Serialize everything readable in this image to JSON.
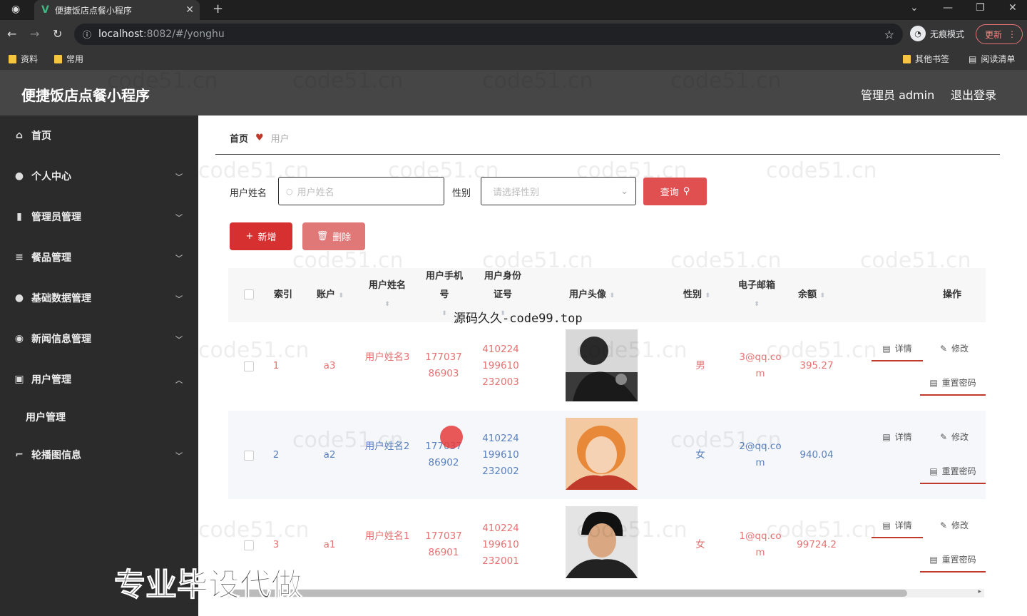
{
  "browser": {
    "tab_title": "便捷饭店点餐小程序",
    "url_host": "localhost",
    "url_path": ":8082/#/yonghu",
    "incognito_label": "无痕模式",
    "update_label": "更新",
    "bookmarks": [
      "资料",
      "常用"
    ],
    "bookmarks_right": [
      "其他书签",
      "阅读清单"
    ]
  },
  "header": {
    "title": "便捷饭店点餐小程序",
    "user": "管理员 admin",
    "logout": "退出登录"
  },
  "sidebar": {
    "items": [
      {
        "label": "首页",
        "icon": "home-icon"
      },
      {
        "label": "个人中心",
        "icon": "user-icon"
      },
      {
        "label": "管理员管理",
        "icon": "bars-icon"
      },
      {
        "label": "餐品管理",
        "icon": "menu-icon"
      },
      {
        "label": "基础数据管理",
        "icon": "user-icon"
      },
      {
        "label": "新闻信息管理",
        "icon": "pin-icon"
      },
      {
        "label": "用户管理",
        "icon": "doc-icon"
      },
      {
        "label": "轮播图信息",
        "icon": "crop-icon"
      }
    ],
    "sub_item": "用户管理"
  },
  "breadcrumb": {
    "home": "首页",
    "current": "用户"
  },
  "search": {
    "name_label": "用户姓名",
    "name_placeholder": "用户姓名",
    "gender_label": "性别",
    "gender_placeholder": "请选择性别",
    "query_label": "查询"
  },
  "actions": {
    "add": "新增",
    "delete": "删除"
  },
  "table": {
    "headers": {
      "index": "索引",
      "account": "账户",
      "name": "用户姓名",
      "phone": "用户手机号",
      "idcard": "用户身份证号",
      "avatar": "用户头像",
      "gender": "性别",
      "email": "电子邮箱",
      "balance": "余额",
      "ops": "操作"
    },
    "rows": [
      {
        "index": "1",
        "account": "a3",
        "name": "用户姓名3",
        "phone": "17703786903",
        "idcard": "410224199610232003",
        "gender": "男",
        "email": "3@qq.com",
        "balance": "395.27"
      },
      {
        "index": "2",
        "account": "a2",
        "name": "用户姓名2",
        "phone": "17703786902",
        "idcard": "410224199610232002",
        "gender": "女",
        "email": "2@qq.com",
        "balance": "940.04"
      },
      {
        "index": "3",
        "account": "a1",
        "name": "用户姓名1",
        "phone": "17703786901",
        "idcard": "410224199610232001",
        "gender": "女",
        "email": "1@qq.com",
        "balance": "99724.2"
      }
    ],
    "op_labels": {
      "detail": "详情",
      "edit": "修改",
      "reset": "重置密码"
    }
  },
  "watermark": "code51.cn",
  "overlay_top": "源码久久-code99.top",
  "overlay_bottom": "专业毕设代做"
}
